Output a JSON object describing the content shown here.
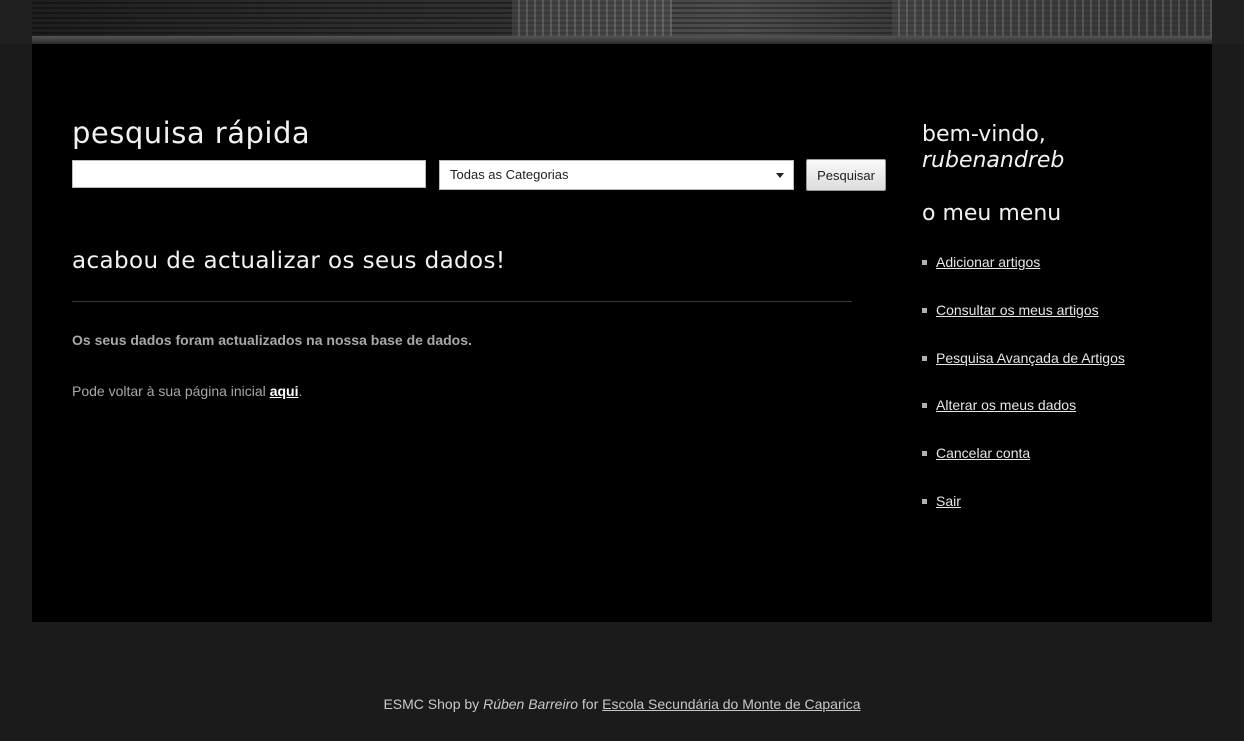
{
  "search": {
    "title": "pesquisa rápida",
    "input_value": "",
    "category_selected": "Todas as Categorias",
    "button_label": "Pesquisar"
  },
  "notice": {
    "title": "acabou de actualizar os seus dados!",
    "message": "Os seus dados foram actualizados na nossa base de dados.",
    "return_prefix": "Pode voltar à sua página inicial ",
    "return_link": "aqui",
    "return_suffix": "."
  },
  "sidebar": {
    "welcome": "bem-vindo,",
    "username": "rubenandreb",
    "menu_title": "o meu menu",
    "items": [
      {
        "label": "Adicionar artigos"
      },
      {
        "label": "Consultar os meus artigos"
      },
      {
        "label": "Pesquisa Avançada de Artigos"
      },
      {
        "label": "Alterar os meus dados"
      },
      {
        "label": "Cancelar conta"
      },
      {
        "label": "Sair"
      }
    ]
  },
  "footer": {
    "prefix": "ESMC Shop by ",
    "author": "Rúben Barreiro",
    "middle": " for ",
    "school": "Escola Secundária do Monte de Caparica"
  },
  "colors": {
    "page_background": "#1b1b1b",
    "content_background": "#000000",
    "heading_text": "#f2f2f2",
    "body_text": "#a8a8a8"
  }
}
